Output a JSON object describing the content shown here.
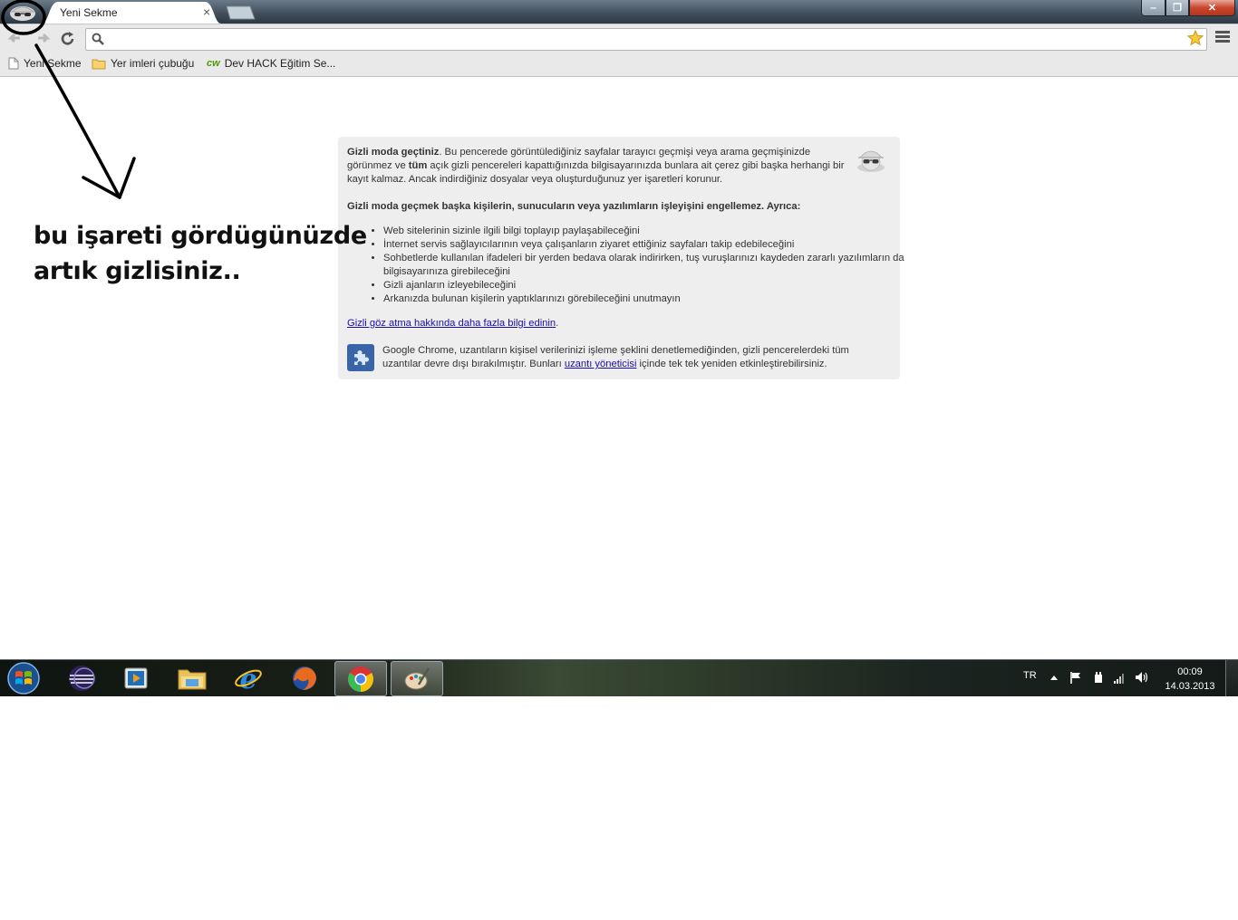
{
  "window": {
    "tab_title": "Yeni Sekme",
    "tab_close": "×",
    "controls": {
      "minimize": "‒",
      "maximize": "❐",
      "close": "✕"
    }
  },
  "toolbar": {
    "back_icon": "back-arrow-icon",
    "forward_icon": "forward-arrow-icon",
    "reload_icon": "reload-icon",
    "omnibox_value": "",
    "star_glyph": "☆"
  },
  "bookmarks": {
    "items": [
      {
        "label": "Yeni Sekme",
        "icon": "page-icon"
      },
      {
        "label": "Yer imleri çubuğu",
        "icon": "folder-icon"
      },
      {
        "label": "Dev HACK Eğitim Se...",
        "icon": "cw-favicon",
        "favicon_text": "cw"
      }
    ]
  },
  "incognito": {
    "p1_bold": "Gizli moda geçtiniz",
    "p1_a": ". Bu pencerede görüntülediğiniz sayfalar tarayıcı geçmişi veya arama geçmişinizde görünmez ve ",
    "p1_bold2": "tüm",
    "p1_b": " açık gizli pencereleri kapattığınızda bilgisayarınızda bunlara ait çerez gibi başka herhangi bir kayıt kalmaz. Ancak indirdiğiniz dosyalar veya oluşturduğunuz yer işaretleri korunur.",
    "p2": "Gizli moda geçmek başka kişilerin, sunucuların veya yazılımların işleyişini engellemez. Ayrıca:",
    "bullets": [
      "Web sitelerinin sizinle ilgili bilgi toplayıp paylaşabileceğini",
      "İnternet servis sağlayıcılarının veya çalışanların ziyaret ettiğiniz sayfaları takip edebileceğini",
      "Sohbetlerde kullanılan ifadeleri bir yerden bedava olarak indirirken, tuş vuruşlarınızı kaydeden zararlı yazılımların da bilgisayarınıza girebileceğini",
      "Gizli ajanların izleyebileceğini",
      "Arkanızda bulunan kişilerin yaptıklarınızı görebileceğini unutmayın"
    ],
    "learn_more_link": "Gizli göz atma hakkında daha fazla bilgi edinin",
    "learn_more_suffix": ".",
    "ext_a": "Google Chrome, uzantıların kişisel verilerinizi işleme şeklini denetlemediğinden, gizli pencerelerdeki tüm uzantılar devre dışı bırakılmıştır. Bunları ",
    "ext_link": "uzantı yöneticisi",
    "ext_b": " içinde tek tek yeniden etkinleştirebilirsiniz."
  },
  "annotation": {
    "line1": "bu işareti gördügünüzde",
    "line2": "artık gizlisiniz.."
  },
  "taskbar": {
    "apps": [
      "start-orb",
      "eclipse",
      "media-player",
      "file-explorer",
      "internet-explorer",
      "firefox",
      "chrome",
      "paint"
    ],
    "active_app": "chrome",
    "language": "TR",
    "time": "00:09",
    "date": "14.03.2013"
  },
  "colors": {
    "link": "#1a0dab",
    "incognito_box": "#eeeeee",
    "toolbar": "#e9e9e9"
  }
}
